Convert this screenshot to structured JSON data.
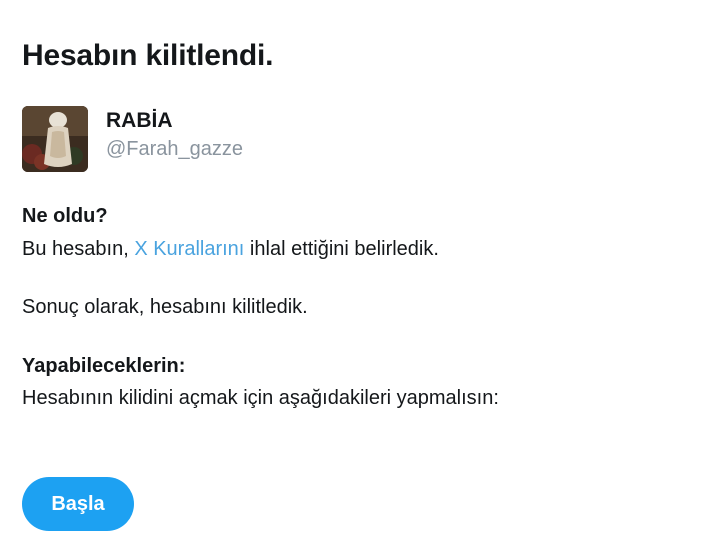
{
  "page": {
    "title": "Hesabın kilitlendi."
  },
  "account": {
    "display_name": "RABİA",
    "handle": "@Farah_gazze",
    "avatar_icon": "profile-photo"
  },
  "what_happened": {
    "heading": "Ne oldu?",
    "text_before_link": "Bu hesabın, ",
    "link_text": "X Kurallarını",
    "text_after_link": " ihlal ettiğini belirledik.",
    "result": "Sonuç olarak, hesabını kilitledik."
  },
  "next_steps": {
    "heading": "Yapabileceklerin:",
    "text": "Hesabının kilidini açmak için aşağıdakileri yapmalısın:"
  },
  "actions": {
    "start_label": "Başla"
  },
  "colors": {
    "link": "#4aa3df",
    "button": "#1da1f2",
    "handle": "#8a949e",
    "text": "#14171a"
  }
}
